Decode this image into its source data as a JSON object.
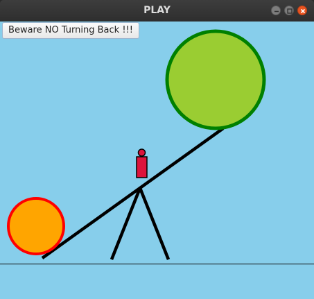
{
  "window": {
    "title": "PLAY"
  },
  "controls": {
    "minimize_icon": "minimize-icon",
    "maximize_icon": "maximize-icon",
    "close_icon": "close-icon"
  },
  "toolbar": {
    "warning_button_label": "Beware NO Turning Back !!!"
  },
  "scene": {
    "colors": {
      "sky": "#87ceeb",
      "ground_line": "#3a5560",
      "plank": "#000000",
      "big_ball_fill": "#9acd32",
      "big_ball_border": "#008000",
      "small_ball_fill": "#ffa500",
      "small_ball_border": "#ff0000",
      "figure_body": "#dc143c"
    }
  }
}
